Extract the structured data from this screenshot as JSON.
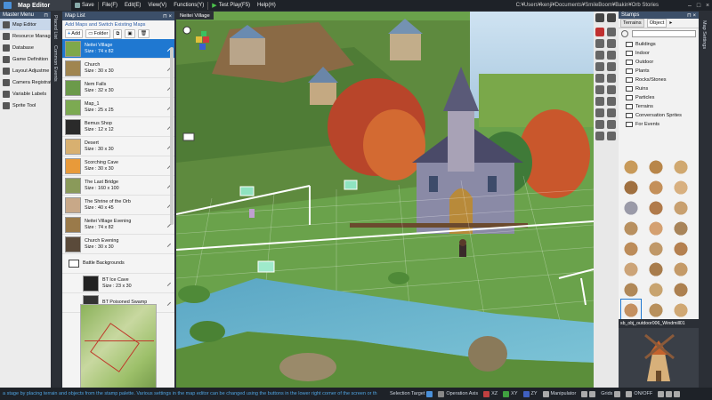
{
  "app": {
    "title": "Map Editor",
    "save_label": "Save",
    "menus": [
      "File(F)",
      "Edit(E)",
      "View(V)",
      "Functions(Y)"
    ],
    "test_play_label": "Test Play(F5)",
    "help_label": "Help(H)",
    "path": "C:¥Users¥kenji¥Documents¥SmileBoom¥Bakin¥Orb Stories"
  },
  "master_menu": {
    "title": "Master Menu",
    "items": [
      {
        "label": "Map Editor",
        "icon": "map-icon",
        "selected": true
      },
      {
        "label": "Resource Manag",
        "icon": "box-icon"
      },
      {
        "label": "Database",
        "icon": "database-icon"
      },
      {
        "label": "Game Definition",
        "icon": "gear-icon"
      },
      {
        "label": "Layout Adjustme",
        "icon": "layout-icon"
      },
      {
        "label": "Camera Registrati",
        "icon": "camera-icon"
      },
      {
        "label": "Variable Labels",
        "icon": "tag-icon"
      },
      {
        "label": "Sprite Tool",
        "icon": "sprite-icon"
      }
    ]
  },
  "vertical_tabs": [
    "Placed List",
    "Common Events"
  ],
  "map_list": {
    "title": "Map List",
    "hint": "Add Maps and Switch Existing Maps",
    "add_label": "Add",
    "folder_label": "Folder",
    "items": [
      {
        "name": "Neitei Village",
        "size": "Size : 74 x 82",
        "selected": true,
        "thumb": "#7fa84a"
      },
      {
        "name": "Church",
        "size": "Size : 30 x 30",
        "thumb": "#a0854f"
      },
      {
        "name": "Nem Falls",
        "size": "Size : 32 x 30",
        "thumb": "#6b9a4a"
      },
      {
        "name": "Map_1",
        "size": "Size : 25 x 25",
        "thumb": "#7caa52"
      },
      {
        "name": "Bemus Shop",
        "size": "Size : 12 x 12",
        "thumb": "#2a2a2a"
      },
      {
        "name": "Desert",
        "size": "Size : 30 x 30",
        "thumb": "#d8b070"
      },
      {
        "name": "Scorching Cave",
        "size": "Size : 30 x 30",
        "thumb": "#e89a3a"
      },
      {
        "name": "The Last Bridge",
        "size": "Size : 160 x 100",
        "thumb": "#8a9a5a"
      },
      {
        "name": "The Shrine of the Orb",
        "size": "Size : 40 x 45",
        "thumb": "#c8a888"
      },
      {
        "name": "Neitei Village Evening",
        "size": "Size : 74 x 82",
        "thumb": "#9a7a4a"
      },
      {
        "name": "Church Evening",
        "size": "Size : 30 x 30",
        "thumb": "#5a4a3a"
      }
    ],
    "folder_item": "Battle Backgrounds",
    "sub_items": [
      {
        "name": "BT Ice Cave",
        "size": "Size : 23 x 30",
        "thumb": "#222222"
      },
      {
        "name": "BT Poisoned Swamp",
        "size": "",
        "thumb": "#333333"
      }
    ]
  },
  "viewport": {
    "tab_label": "Neitei Village"
  },
  "stamps": {
    "title": "Stamps",
    "tabs": [
      "Terrains",
      "Object"
    ],
    "folders": [
      "Buildings",
      "Indoor",
      "Outdoor",
      "Plants",
      "Rocks/Stones",
      "Ruins",
      "Particles",
      "Terrains",
      "Conversation Sprites",
      "For Events"
    ],
    "selected_name": "sb_obj_outdoor006_Windmill01"
  },
  "far_right_tab": "Map Settings",
  "status": {
    "message": "a stage by placing terrain and objects from the stamp palette.  Various settings in the map editor can be changed using the buttons in the lower right corner of the screen or th",
    "selection_target": "Selection Target",
    "operation_axis": "Operation Axis",
    "axes": [
      "XZ",
      "XY",
      "ZY"
    ],
    "manipulator": "Manipulator",
    "grids": "Grids",
    "onoff": "ON/OFF"
  }
}
